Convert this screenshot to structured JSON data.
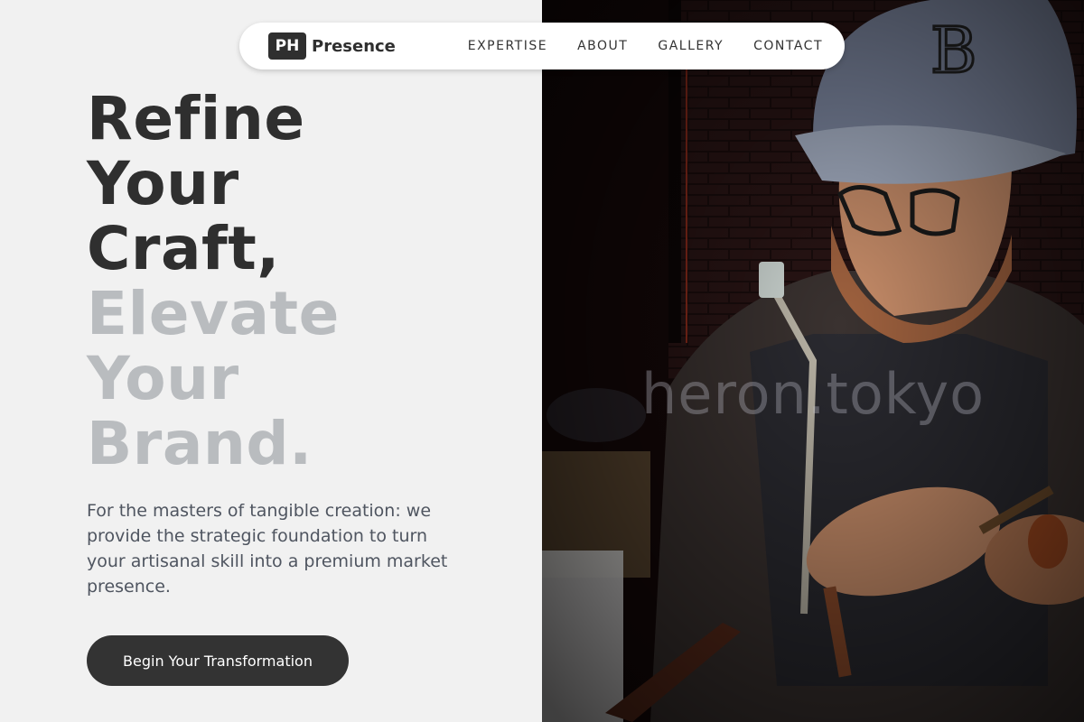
{
  "nav": {
    "brand_mark": "PH",
    "brand_name": "Presence",
    "links": [
      "EXPERTISE",
      "ABOUT",
      "GALLERY",
      "CONTACT"
    ]
  },
  "hero": {
    "headline_dark": [
      "Refine",
      "Your",
      "Craft,"
    ],
    "headline_light": [
      "Elevate",
      "Your",
      "Brand."
    ],
    "lede": "For the masters of tangible creation: we provide the strategic foundation to turn your artisanal skill into a premium market presence.",
    "cta_label": "Begin Your Transformation"
  },
  "photo": {
    "watermark": "heron.tokyo"
  },
  "colors": {
    "background": "#f1f1f1",
    "text_dark": "#2f2f2f",
    "text_light": "#b9bcbf",
    "cta_bg": "#333333"
  }
}
